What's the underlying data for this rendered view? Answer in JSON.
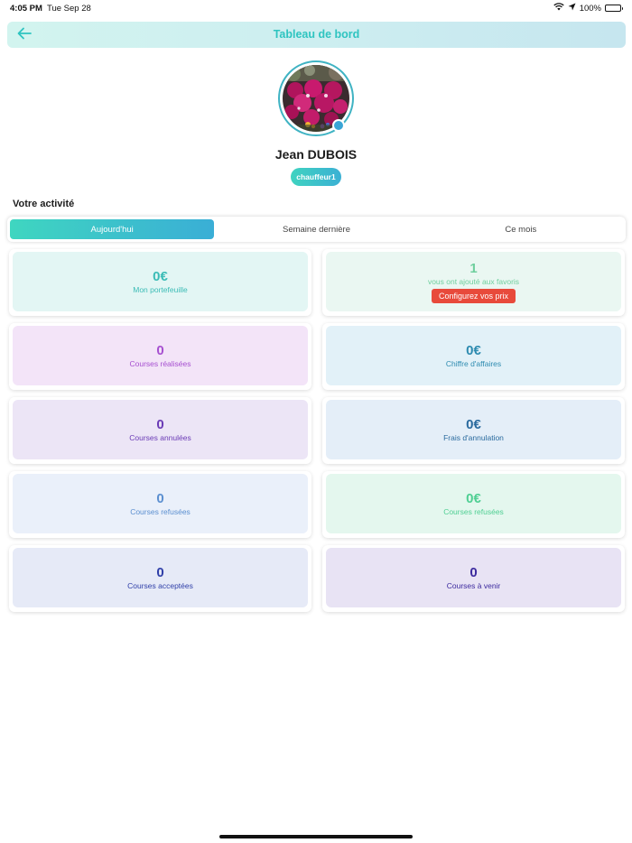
{
  "status_bar": {
    "time": "4:05 PM",
    "date": "Tue Sep 28",
    "battery": "100%"
  },
  "header": {
    "title": "Tableau de bord"
  },
  "profile": {
    "name": "Jean DUBOIS",
    "role": "chauffeur1"
  },
  "activity": {
    "title": "Votre activité",
    "tabs": [
      {
        "label": "Aujourd'hui",
        "active": true
      },
      {
        "label": "Semaine dernière",
        "active": false
      },
      {
        "label": "Ce mois",
        "active": false
      }
    ]
  },
  "cards": [
    {
      "value": "0€",
      "label": "Mon portefeuille",
      "bg": "#e3f6f4",
      "color": "#3bbcb6"
    },
    {
      "value": "1",
      "label": "vous ont ajouté aux favoris",
      "bg": "#eaf7f2",
      "color": "#6fcf9e",
      "button": "Configurez vos prix"
    },
    {
      "value": "0",
      "label": "Courses réalisées",
      "bg": "#f3e4f8",
      "color": "#a64fd0"
    },
    {
      "value": "0€",
      "label": "Chiffre d'affaires",
      "bg": "#e2f1f8",
      "color": "#2d8bb0"
    },
    {
      "value": "0",
      "label": "Courses annulées",
      "bg": "#ece5f6",
      "color": "#6a3ab5"
    },
    {
      "value": "0€",
      "label": "Frais d'annulation",
      "bg": "#e4eef8",
      "color": "#2a6a9e"
    },
    {
      "value": "0",
      "label": "Courses refusées",
      "bg": "#eaf0fa",
      "color": "#5b8fd0"
    },
    {
      "value": "0€",
      "label": "Courses refusées",
      "bg": "#e4f7ee",
      "color": "#4fcf93"
    },
    {
      "value": "0",
      "label": "Courses acceptées",
      "bg": "#e6eaf7",
      "color": "#2f3fa8"
    },
    {
      "value": "0",
      "label": "Courses à venir",
      "bg": "#e8e3f4",
      "color": "#3c2a9e"
    }
  ],
  "colors": {
    "accent": "#2ec4c0",
    "tab_gradient_start": "#3fd6c0",
    "tab_gradient_end": "#3aaed6",
    "cta": "#e84a3b"
  }
}
